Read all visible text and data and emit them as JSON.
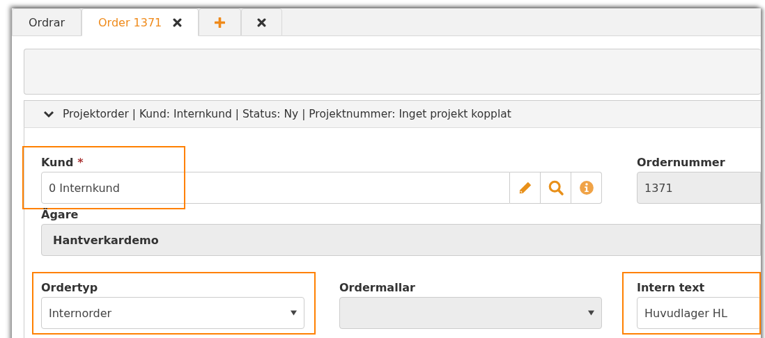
{
  "tabs": [
    {
      "kind": "text",
      "label": "Ordrar",
      "selected": false,
      "closable": false
    },
    {
      "kind": "text",
      "label": "Order 1371",
      "selected": true,
      "closable": true
    },
    {
      "kind": "add",
      "selected": false
    },
    {
      "kind": "close",
      "selected": false
    }
  ],
  "summary": {
    "expanded": true,
    "text": "Projektorder | Kund: Internkund | Status: Ny | Projektnummer: Inget projekt kopplat"
  },
  "fields": [
    {
      "kind": "lookup",
      "label": "Kund",
      "mark": "*",
      "value": "0 Internkund",
      "highlighted": true
    },
    {
      "kind": "readonly",
      "label": "Ordernummer",
      "value": "1371",
      "highlighted": false
    },
    {
      "kind": "owner",
      "label": "Ägare",
      "value": "Hantverkardemo",
      "highlighted": false
    },
    {
      "kind": "select",
      "label": "Ordertyp",
      "value": "Internorder",
      "disabled": false,
      "highlighted": true
    },
    {
      "kind": "select",
      "label": "Ordermallar",
      "disabled": true,
      "highlighted": false
    },
    {
      "kind": "text",
      "label": "Intern text",
      "value": "Huvudlager HL",
      "highlighted": true
    }
  ]
}
